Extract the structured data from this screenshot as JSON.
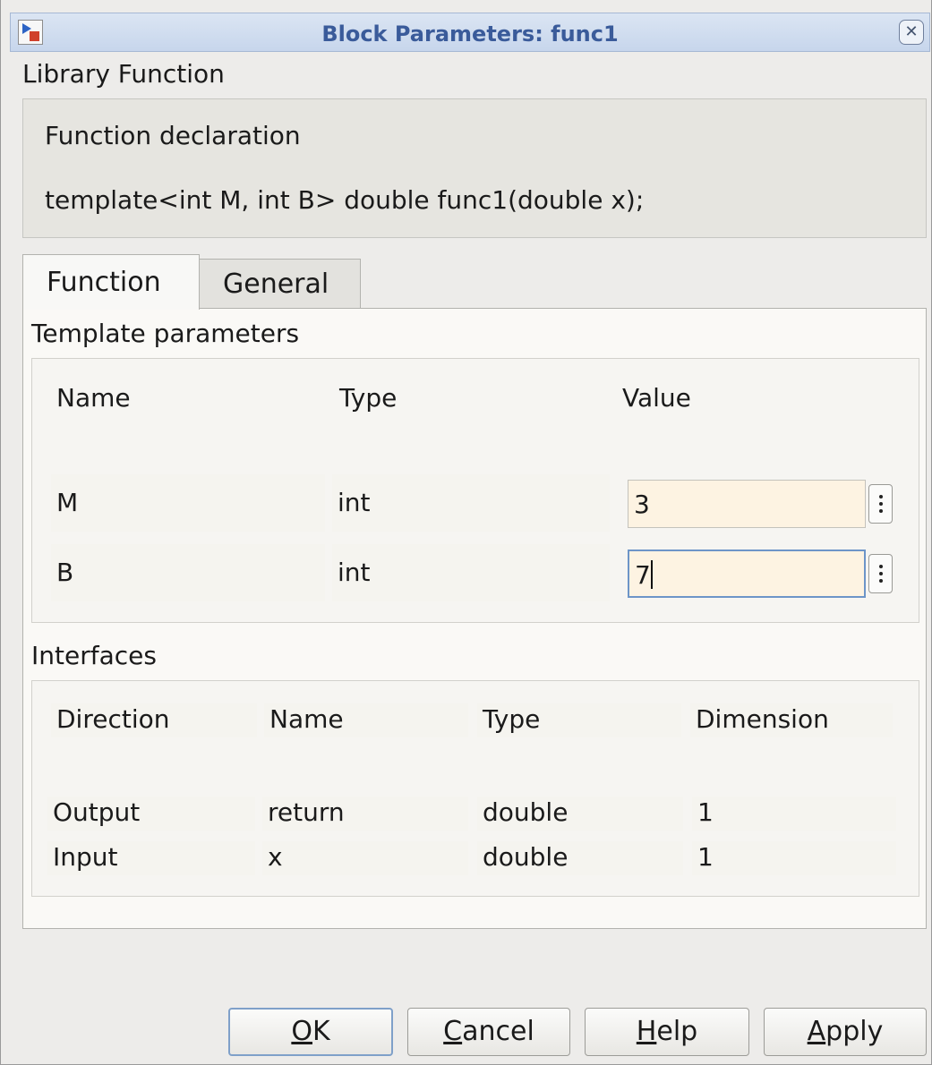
{
  "window": {
    "title": "Block Parameters: func1"
  },
  "library_function_label": "Library Function",
  "declaration": {
    "heading": "Function declaration",
    "code": "template<int M, int B> double func1(double x);"
  },
  "tabs": [
    {
      "label": "Function",
      "active": true
    },
    {
      "label": "General",
      "active": false
    }
  ],
  "template_parameters": {
    "heading": "Template parameters",
    "columns": [
      "Name",
      "Type",
      "Value"
    ],
    "rows": [
      {
        "name": "M",
        "type": "int",
        "value": "3"
      },
      {
        "name": "B",
        "type": "int",
        "value": "7"
      }
    ]
  },
  "interfaces": {
    "heading": "Interfaces",
    "columns": [
      "Direction",
      "Name",
      "Type",
      "Dimension"
    ],
    "rows": [
      {
        "direction": "Output",
        "name": "return",
        "type": "double",
        "dimension": "1"
      },
      {
        "direction": "Input",
        "name": "x",
        "type": "double",
        "dimension": "1"
      }
    ]
  },
  "buttons": {
    "ok": {
      "mnemonic": "O",
      "rest": "K"
    },
    "cancel": {
      "mnemonic": "C",
      "rest": "ancel"
    },
    "help": {
      "mnemonic": "H",
      "rest": "elp"
    },
    "apply": {
      "mnemonic": "A",
      "rest": "pply"
    }
  },
  "colors": {
    "title_text": "#3a5b9a",
    "input_bg": "#fdf3e2",
    "focus_border": "#6d95c8"
  }
}
